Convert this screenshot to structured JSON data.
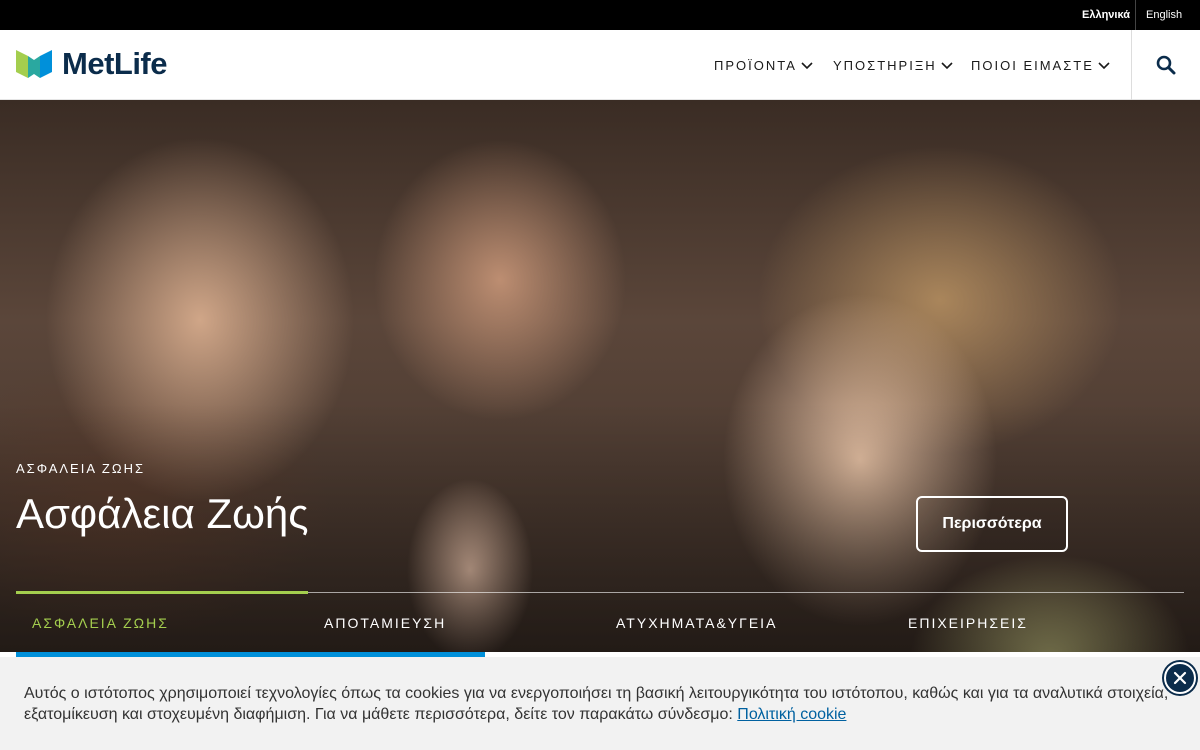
{
  "topbar": {
    "languages": [
      {
        "label": "Ελληνικά",
        "active": true
      },
      {
        "label": "English",
        "active": false
      }
    ]
  },
  "header": {
    "logo_text": "MetLife",
    "nav": [
      {
        "label": "ΠΡΟΪΟΝΤΑ"
      },
      {
        "label": "ΥΠΟΣΤΗΡΙΞΗ"
      },
      {
        "label": "ΠΟΙΟΙ ΕΙΜΑΣΤΕ"
      }
    ],
    "search_icon": "search-icon"
  },
  "hero": {
    "eyebrow": "ΑΣΦΑΛΕΙΑ ΖΩΗΣ",
    "title": "Ασφάλεια Ζωής",
    "cta_label": "Περισσότερα",
    "tabs": [
      {
        "label": "ΑΣΦΑΛΕΙΑ ΖΩΗΣ",
        "active": true
      },
      {
        "label": "ΑΠΟΤΑΜΙΕΥΣΗ",
        "active": false
      },
      {
        "label": "ΑΤΥΧΗΜΑΤΑ&ΥΓΕΙΑ",
        "active": false
      },
      {
        "label": "ΕΠΙΧΕΙΡΗΣΕΙΣ",
        "active": false
      }
    ]
  },
  "cookie_banner": {
    "text": "Αυτός ο ιστότοπος χρησιμοποιεί τεχνολογίες όπως τα cookies για να ενεργοποιήσει τη βασική λειτουργικότητα του ιστότοπου, καθώς και για τα αναλυτικά στοιχεία, εξατομίκευση και στοχευμένη διαφήμιση. Για να μάθετε περισσότερα, δείτε τον παρακάτω σύνδεσμο: ",
    "link_label": "Πολιτική cookie"
  },
  "colors": {
    "brand_navy": "#0b2c4b",
    "accent_green": "#a4ce4e",
    "accent_blue": "#0090da",
    "link_blue": "#0061a0"
  }
}
